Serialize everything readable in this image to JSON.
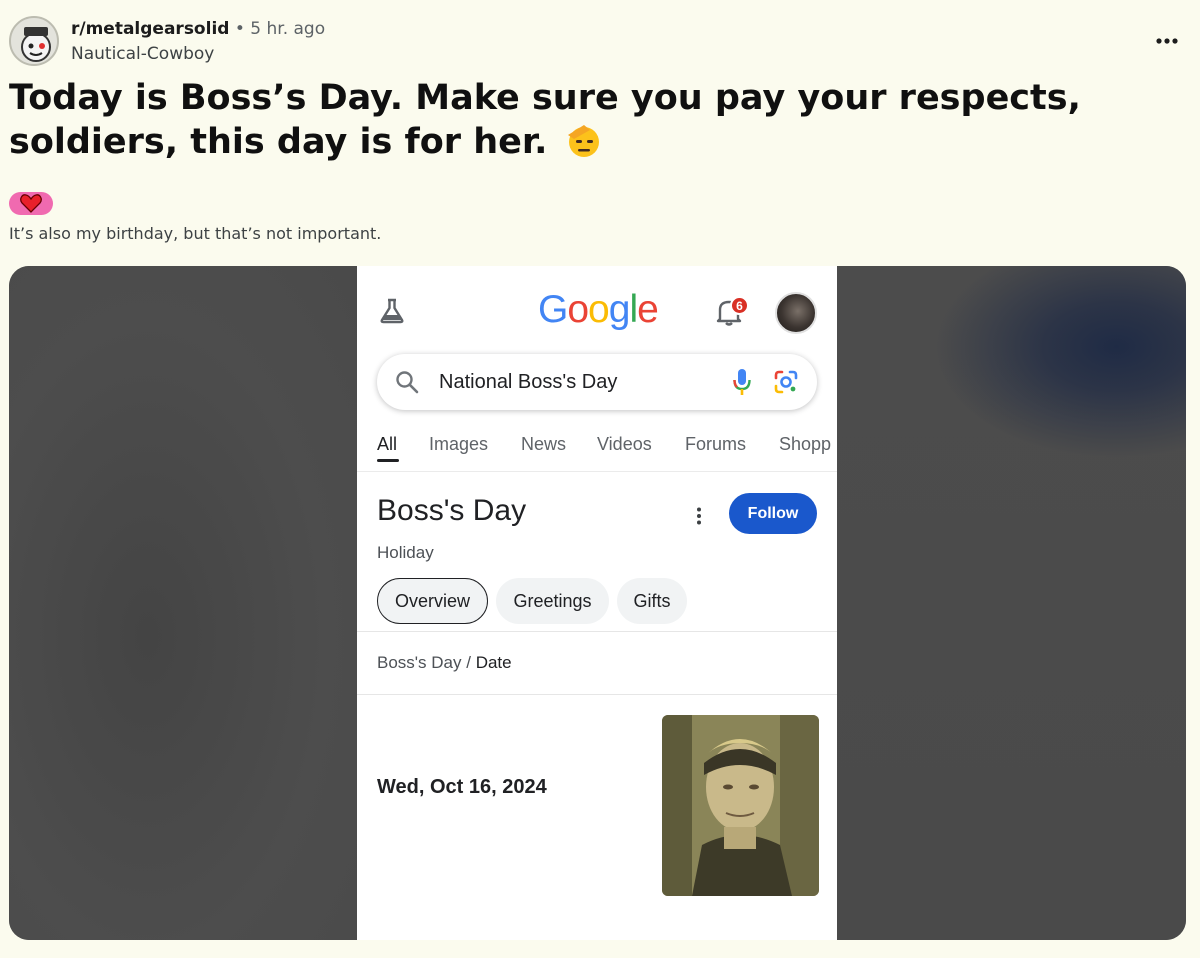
{
  "post": {
    "subreddit": "r/metalgearsolid",
    "separator": "•",
    "time_ago": "5 hr. ago",
    "author": "Nautical-Cowboy",
    "title": "Today is Boss’s Day. Make sure you pay your respects, soldiers, this day is for her.",
    "title_emoji": "saluting-face-emoji",
    "flair_icon": "heart-icon",
    "body": "It’s also my birthday, but that’s not important.",
    "more_icon": "more-dots-icon"
  },
  "screenshot": {
    "logo": "Google",
    "notification_count": "6",
    "search": {
      "query": "National Boss's Day"
    },
    "tabs": [
      {
        "label": "All",
        "active": true
      },
      {
        "label": "Images"
      },
      {
        "label": "News"
      },
      {
        "label": "Videos"
      },
      {
        "label": "Forums"
      },
      {
        "label": "Shopp"
      }
    ],
    "knowledge_panel": {
      "title": "Boss's Day",
      "subtitle": "Holiday",
      "follow_label": "Follow",
      "chips": [
        {
          "label": "Overview",
          "active": true
        },
        {
          "label": "Greetings"
        },
        {
          "label": "Gifts"
        }
      ],
      "breadcrumb": {
        "parent": "Boss's Day",
        "sep": "/",
        "current": "Date"
      },
      "date": "Wed, Oct 16, 2024"
    }
  },
  "colors": {
    "page_bg": "#fbfbee",
    "flair_bg": "#f06ab0",
    "follow_bg": "#1a58cc",
    "badge": "#d93025",
    "google_blue": "#4285f4",
    "google_red": "#ea4335",
    "google_yellow": "#fbbc05",
    "google_green": "#34a853"
  }
}
